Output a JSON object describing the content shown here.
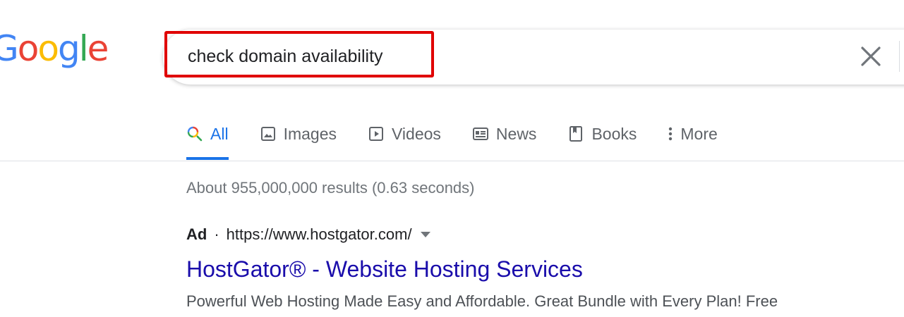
{
  "logo": {
    "letters": [
      {
        "char": "G",
        "color": "#4285F4"
      },
      {
        "char": "o",
        "color": "#EA4335"
      },
      {
        "char": "o",
        "color": "#FBBC05"
      },
      {
        "char": "g",
        "color": "#4285F4"
      },
      {
        "char": "l",
        "color": "#34A853"
      },
      {
        "char": "e",
        "color": "#EA4335"
      }
    ]
  },
  "search": {
    "value": "check domain availability",
    "highlight_color": "#e00000"
  },
  "tabs": [
    {
      "label": "All",
      "icon": "search-icon",
      "active": true
    },
    {
      "label": "Images",
      "icon": "image-icon",
      "active": false
    },
    {
      "label": "Videos",
      "icon": "play-icon",
      "active": false
    },
    {
      "label": "News",
      "icon": "news-icon",
      "active": false
    },
    {
      "label": "Books",
      "icon": "book-icon",
      "active": false
    },
    {
      "label": "More",
      "icon": "more-vertical-icon",
      "active": false
    }
  ],
  "results": {
    "stats": "About 955,000,000 results (0.63 seconds)",
    "ad": {
      "label": "Ad",
      "separator": "·",
      "url": "https://www.hostgator.com/",
      "title": "HostGator® - Website Hosting Services",
      "snippet": "Powerful Web Hosting Made Easy and Affordable. Great Bundle with Every Plan! Free"
    }
  },
  "colors": {
    "link": "#1a0dab",
    "active_tab": "#1a73e8",
    "muted": "#70757a"
  }
}
